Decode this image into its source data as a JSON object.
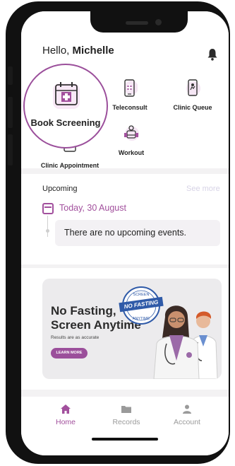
{
  "header": {
    "greeting": "Hello,",
    "user_name": "Michelle"
  },
  "quick_actions": {
    "book_screening": "Book Screening",
    "teleconsult": "Teleconsult",
    "clinic_queue": "Clinic Queue",
    "clinic_appointment": "Clinic Appointment",
    "workout": "Workout"
  },
  "upcoming": {
    "title": "Upcoming",
    "see_more": "See more",
    "date": "Today, 30 August",
    "empty_message": "There are no upcoming events."
  },
  "banner": {
    "line1": "No Fasting,",
    "line2": "Screen Anytime",
    "subtitle": "Results are as accurate",
    "button": "LEARN MORE",
    "badge_top": "SCREEN",
    "badge_main": "NO FASTING",
    "badge_bottom": "ANYTIME"
  },
  "tabs": [
    {
      "label": "Home",
      "icon": "home-icon",
      "active": true
    },
    {
      "label": "Records",
      "icon": "folder-icon",
      "active": false
    },
    {
      "label": "Account",
      "icon": "person-icon",
      "active": false
    }
  ],
  "colors": {
    "accent": "#a2509d",
    "inactive": "#9a9a9a",
    "banner_bg": "#ecebed"
  }
}
